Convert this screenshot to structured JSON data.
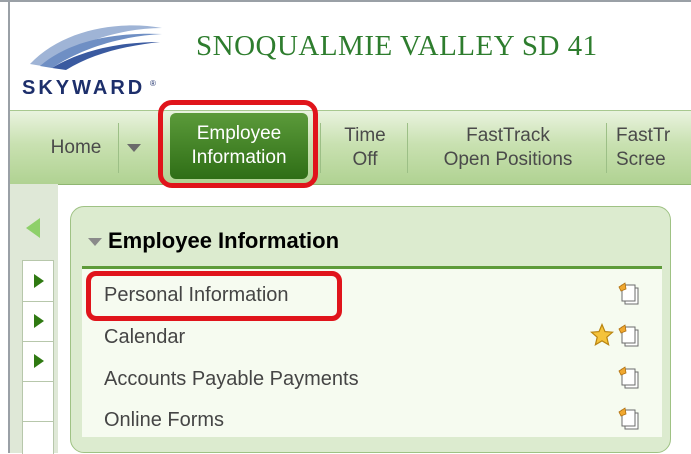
{
  "header": {
    "logo_text": "SKYWARD",
    "district_name": "SNOQUALMIE VALLEY SD 41"
  },
  "nav": {
    "home": "Home",
    "employee_info": [
      "Employee",
      "Information"
    ],
    "time_off": [
      "Time",
      "Off"
    ],
    "fasttrack_open": [
      "FastTrack",
      "Open Positions"
    ],
    "fasttrack_screen": [
      "FastTr",
      "Scree"
    ]
  },
  "panel": {
    "title": "Employee Information",
    "items": [
      {
        "label": "Personal Information",
        "favorite": false
      },
      {
        "label": "Calendar",
        "favorite": true
      },
      {
        "label": "Accounts Payable Payments",
        "favorite": false
      },
      {
        "label": "Online Forms",
        "favorite": false
      }
    ]
  },
  "colors": {
    "highlight": "#e0141b",
    "nav_active": "#3c7d1f",
    "district_text": "#2e7d2e"
  },
  "icons": [
    "skyward-logo",
    "dropdown-caret-icon",
    "collapse-left-icon",
    "expand-right-icon",
    "section-collapse-icon",
    "favorite-star-icon",
    "page-icon"
  ]
}
